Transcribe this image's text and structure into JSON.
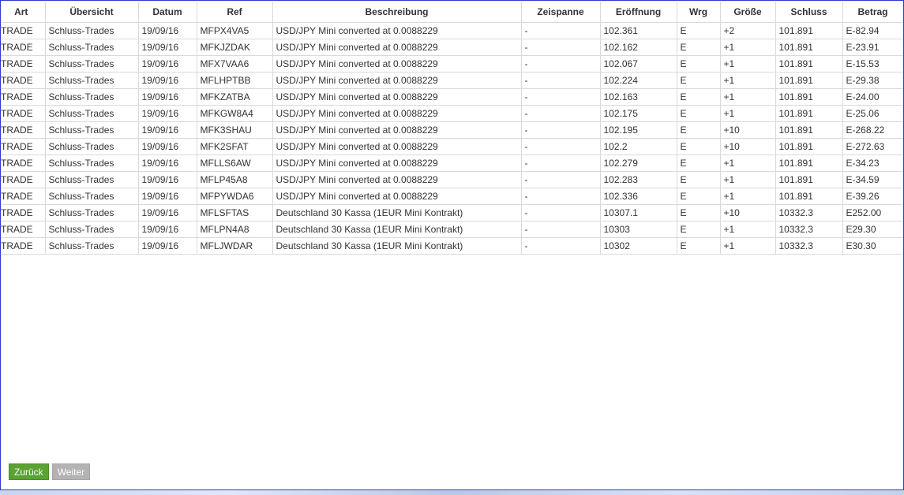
{
  "table": {
    "headers": [
      "Art",
      "Übersicht",
      "Datum",
      "Ref",
      "Beschreibung",
      "Zeispanne",
      "Eröffnung",
      "Wrg",
      "Größe",
      "Schluss",
      "Betrag"
    ],
    "rows": [
      [
        "TRADE",
        "Schluss-Trades",
        "19/09/16",
        "MFPX4VA5",
        "USD/JPY Mini converted at 0.0088229",
        "-",
        "102.361",
        "E",
        "+2",
        "101.891",
        "E-82.94"
      ],
      [
        "TRADE",
        "Schluss-Trades",
        "19/09/16",
        "MFKJZDAK",
        "USD/JPY Mini converted at 0.0088229",
        "-",
        "102.162",
        "E",
        "+1",
        "101.891",
        "E-23.91"
      ],
      [
        "TRADE",
        "Schluss-Trades",
        "19/09/16",
        "MFX7VAA6",
        "USD/JPY Mini converted at 0.0088229",
        "-",
        "102.067",
        "E",
        "+1",
        "101.891",
        "E-15.53"
      ],
      [
        "TRADE",
        "Schluss-Trades",
        "19/09/16",
        "MFLHPTBB",
        "USD/JPY Mini converted at 0.0088229",
        "-",
        "102.224",
        "E",
        "+1",
        "101.891",
        "E-29.38"
      ],
      [
        "TRADE",
        "Schluss-Trades",
        "19/09/16",
        "MFKZATBA",
        "USD/JPY Mini converted at 0.0088229",
        "-",
        "102.163",
        "E",
        "+1",
        "101.891",
        "E-24.00"
      ],
      [
        "TRADE",
        "Schluss-Trades",
        "19/09/16",
        "MFKGW8A4",
        "USD/JPY Mini converted at 0.0088229",
        "-",
        "102.175",
        "E",
        "+1",
        "101.891",
        "E-25.06"
      ],
      [
        "TRADE",
        "Schluss-Trades",
        "19/09/16",
        "MFK3SHAU",
        "USD/JPY Mini converted at 0.0088229",
        "-",
        "102.195",
        "E",
        "+10",
        "101.891",
        "E-268.22"
      ],
      [
        "TRADE",
        "Schluss-Trades",
        "19/09/16",
        "MFK2SFAT",
        "USD/JPY Mini converted at 0.0088229",
        "-",
        "102.2",
        "E",
        "+10",
        "101.891",
        "E-272.63"
      ],
      [
        "TRADE",
        "Schluss-Trades",
        "19/09/16",
        "MFLLS6AW",
        "USD/JPY Mini converted at 0.0088229",
        "-",
        "102.279",
        "E",
        "+1",
        "101.891",
        "E-34.23"
      ],
      [
        "TRADE",
        "Schluss-Trades",
        "19/09/16",
        "MFLP45A8",
        "USD/JPY Mini converted at 0.0088229",
        "-",
        "102.283",
        "E",
        "+1",
        "101.891",
        "E-34.59"
      ],
      [
        "TRADE",
        "Schluss-Trades",
        "19/09/16",
        "MFPYWDA6",
        "USD/JPY Mini converted at 0.0088229",
        "-",
        "102.336",
        "E",
        "+1",
        "101.891",
        "E-39.26"
      ],
      [
        "TRADE",
        "Schluss-Trades",
        "19/09/16",
        "MFLSFTAS",
        "Deutschland 30 Kassa (1EUR Mini Kontrakt)",
        "-",
        "10307.1",
        "E",
        "+10",
        "10332.3",
        "E252.00"
      ],
      [
        "TRADE",
        "Schluss-Trades",
        "19/09/16",
        "MFLPN4A8",
        "Deutschland 30 Kassa (1EUR Mini Kontrakt)",
        "-",
        "10303",
        "E",
        "+1",
        "10332.3",
        "E29.30"
      ],
      [
        "TRADE",
        "Schluss-Trades",
        "19/09/16",
        "MFLJWDAR",
        "Deutschland 30 Kassa (1EUR Mini Kontrakt)",
        "-",
        "10302",
        "E",
        "+1",
        "10332.3",
        "E30.30"
      ]
    ]
  },
  "pager": {
    "back_label": "Zurück",
    "next_label": "Weiter"
  },
  "colors": {
    "frame_border": "#2a3bd0",
    "back_button": "#5aa232",
    "next_button": "#b3b3b3",
    "grid_line": "#d9d9d9"
  }
}
